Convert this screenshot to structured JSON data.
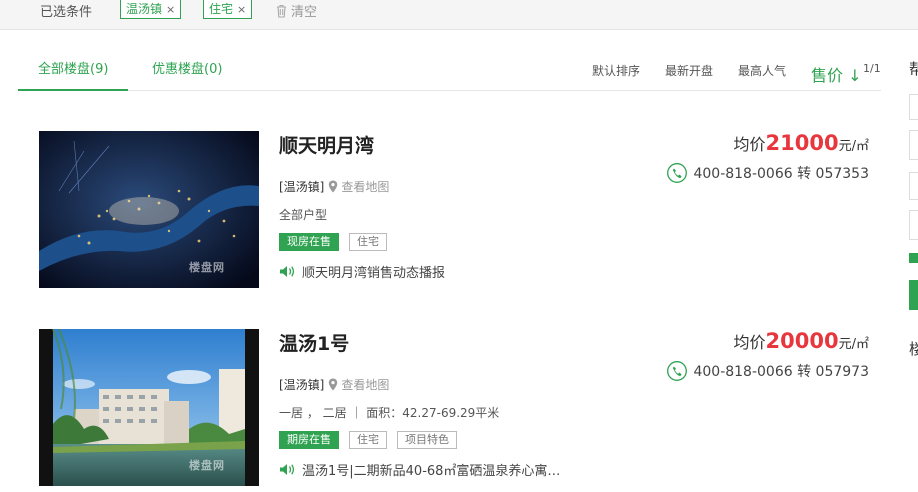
{
  "filters": {
    "label": "已选条件",
    "tags": [
      "温汤镇",
      "住宅"
    ],
    "remove_glyph": "×",
    "clear_label": "清空"
  },
  "tabs": [
    {
      "label": "全部楼盘(9)"
    },
    {
      "label": "优惠楼盘(0)"
    }
  ],
  "sort": {
    "default": "默认排序",
    "newest": "最新开盘",
    "popular": "最高人气",
    "price": "售价",
    "price_arrow": "↓",
    "page": "1/1"
  },
  "right_edge": {
    "heading1": "帮",
    "heading2": "楼"
  },
  "listings": [
    {
      "name": "顺天明月湾",
      "district": "[温汤镇]",
      "map_label": "查看地图",
      "layout": "全部户型",
      "badges": [
        "现房在售",
        "住宅"
      ],
      "news": "顺天明月湾销售动态播报",
      "price_prefix": "均价",
      "price_value": "21000",
      "price_unit": "元/㎡",
      "phone": "400-818-0066 转 057353"
    },
    {
      "name": "温汤1号",
      "district": "[温汤镇]",
      "map_label": "查看地图",
      "layout": "一居 ， 二居 ｜ 面积：42.27-69.29平米",
      "badges": [
        "期房在售",
        "住宅",
        "项目特色"
      ],
      "news": "温汤1号|二期新品40-68㎡富硒温泉养心寓…",
      "price_prefix": "均价",
      "price_value": "20000",
      "price_unit": "元/㎡",
      "phone": "400-818-0066 转 057973"
    }
  ],
  "watermark": "楼盘网",
  "colors": {
    "accent": "#2fa351",
    "price": "#e8363d"
  }
}
